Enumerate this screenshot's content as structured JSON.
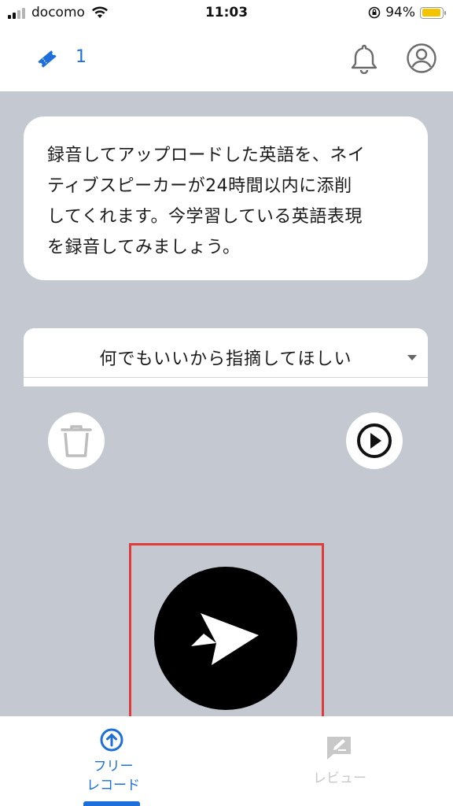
{
  "status_bar": {
    "carrier": "docomo",
    "time": "11:03",
    "battery": "94%",
    "battery_level": 0.94
  },
  "header": {
    "ticket_count": "1",
    "icons": [
      "ticket-icon",
      "bell-icon",
      "user-icon"
    ]
  },
  "info_card": {
    "lines": [
      "録音してアップロードした英語を、ネイ",
      "ティブスピーカーが24時間以内に添削",
      "してくれます。今学習している英語表現",
      "を録音してみましょう。"
    ]
  },
  "feedback_select": {
    "value": "何でもいいから指摘してほしい"
  },
  "controls": {
    "icons": [
      "trash-icon",
      "play-icon",
      "send-icon"
    ]
  },
  "bottom_nav": {
    "items": [
      {
        "label_line1": "フリー",
        "label_line2": "レコード",
        "active": true
      },
      {
        "label": "レビュー",
        "active": false
      }
    ]
  },
  "colors": {
    "accent": "#1e6fd9",
    "main_bg": "#c3c8d1",
    "highlight": "#e03b3b",
    "battery": "#f5c400"
  }
}
